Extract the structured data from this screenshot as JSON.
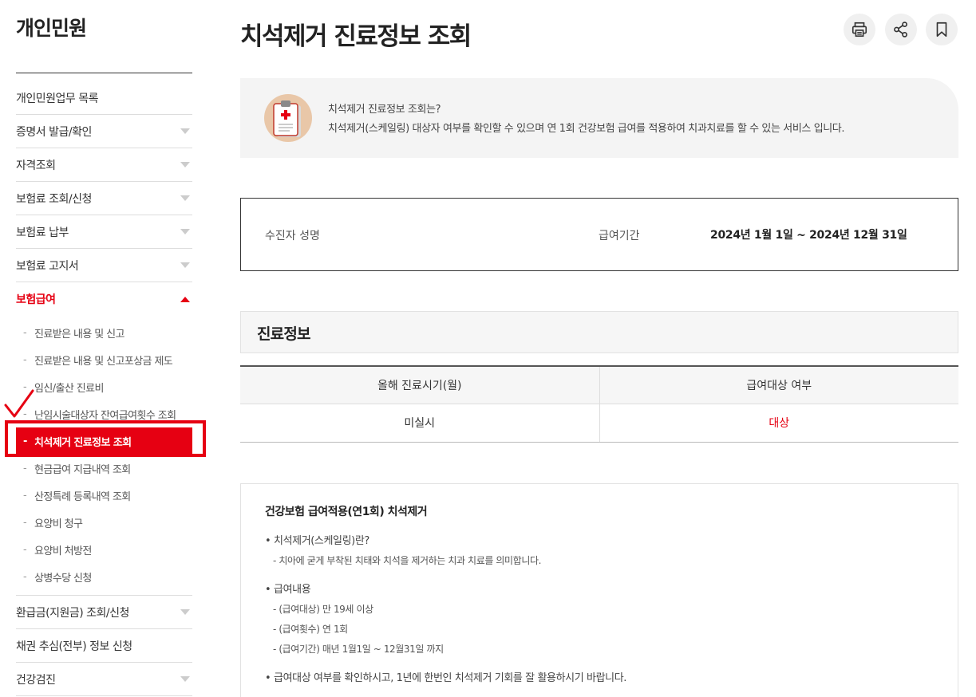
{
  "sidebar": {
    "title": "개인민원",
    "items": [
      {
        "label": "개인민원업무 목록"
      },
      {
        "label": "증명서 발급/확인"
      },
      {
        "label": "자격조회"
      },
      {
        "label": "보험료 조회/신청"
      },
      {
        "label": "보험료 납부"
      },
      {
        "label": "보험료 고지서"
      },
      {
        "label": "보험급여"
      },
      {
        "label": "환급금(지원금) 조회/신청"
      },
      {
        "label": "채권 추심(전부) 정보 신청"
      },
      {
        "label": "건강검진"
      }
    ],
    "sub_items": [
      {
        "label": "진료받은 내용 및 신고"
      },
      {
        "label": "진료받은 내용 및 신고포상금 제도"
      },
      {
        "label": "임신/출산 진료비"
      },
      {
        "label": "난임시술대상자 잔여급여횟수 조회"
      },
      {
        "label": "치석제거 진료정보 조회"
      },
      {
        "label": "현금급여 지급내역 조회"
      },
      {
        "label": "산정특례 등록내역 조회"
      },
      {
        "label": "요양비 청구"
      },
      {
        "label": "요양비 처방전"
      },
      {
        "label": "상병수당 신청"
      }
    ],
    "dash": "-"
  },
  "page": {
    "title": "치석제거 진료정보 조회"
  },
  "toolbar": {
    "print_icon": "printer-icon",
    "share_icon": "share-icon",
    "bookmark_icon": "bookmark-icon"
  },
  "info": {
    "question": "치석제거 진료정보 조회는?",
    "description": "치석제거(스케일링) 대상자 여부를 확인할 수 있으며 연 1회 건강보험 급여를 적용하여 치과치료를 할 수 있는 서비스 입니다."
  },
  "person": {
    "name_label": "수진자 성명",
    "period_label": "급여기간",
    "period_value": "2024년 1월 1일 ~ 2024년 12월 31일"
  },
  "section": {
    "title": "진료정보"
  },
  "table": {
    "headers": [
      "올해 진료시기(월)",
      "급여대상 여부"
    ],
    "row": [
      "미실시",
      "대상"
    ]
  },
  "notice": {
    "title": "건강보험 급여적용(연1회) 치석제거",
    "b1": "치석제거(스케일링)란?",
    "b1_sub": "치아에 굳게 부착된 치태와 치석을 제거하는 치과 치료를 의미합니다.",
    "b2": "급여내용",
    "b2_subs": [
      "(급여대상) 만 19세 이상",
      "(급여횟수) 연 1회",
      "(급여기간) 매년 1월1일 ~ 12월31일 까지"
    ],
    "b3": "급여대상 여부를 확인하시고, 1년에 한번인 치석제거 기회를 잘 활용하시기 바랍니다."
  },
  "colors": {
    "accent": "#e60012",
    "panel": "#f4f4f4"
  }
}
